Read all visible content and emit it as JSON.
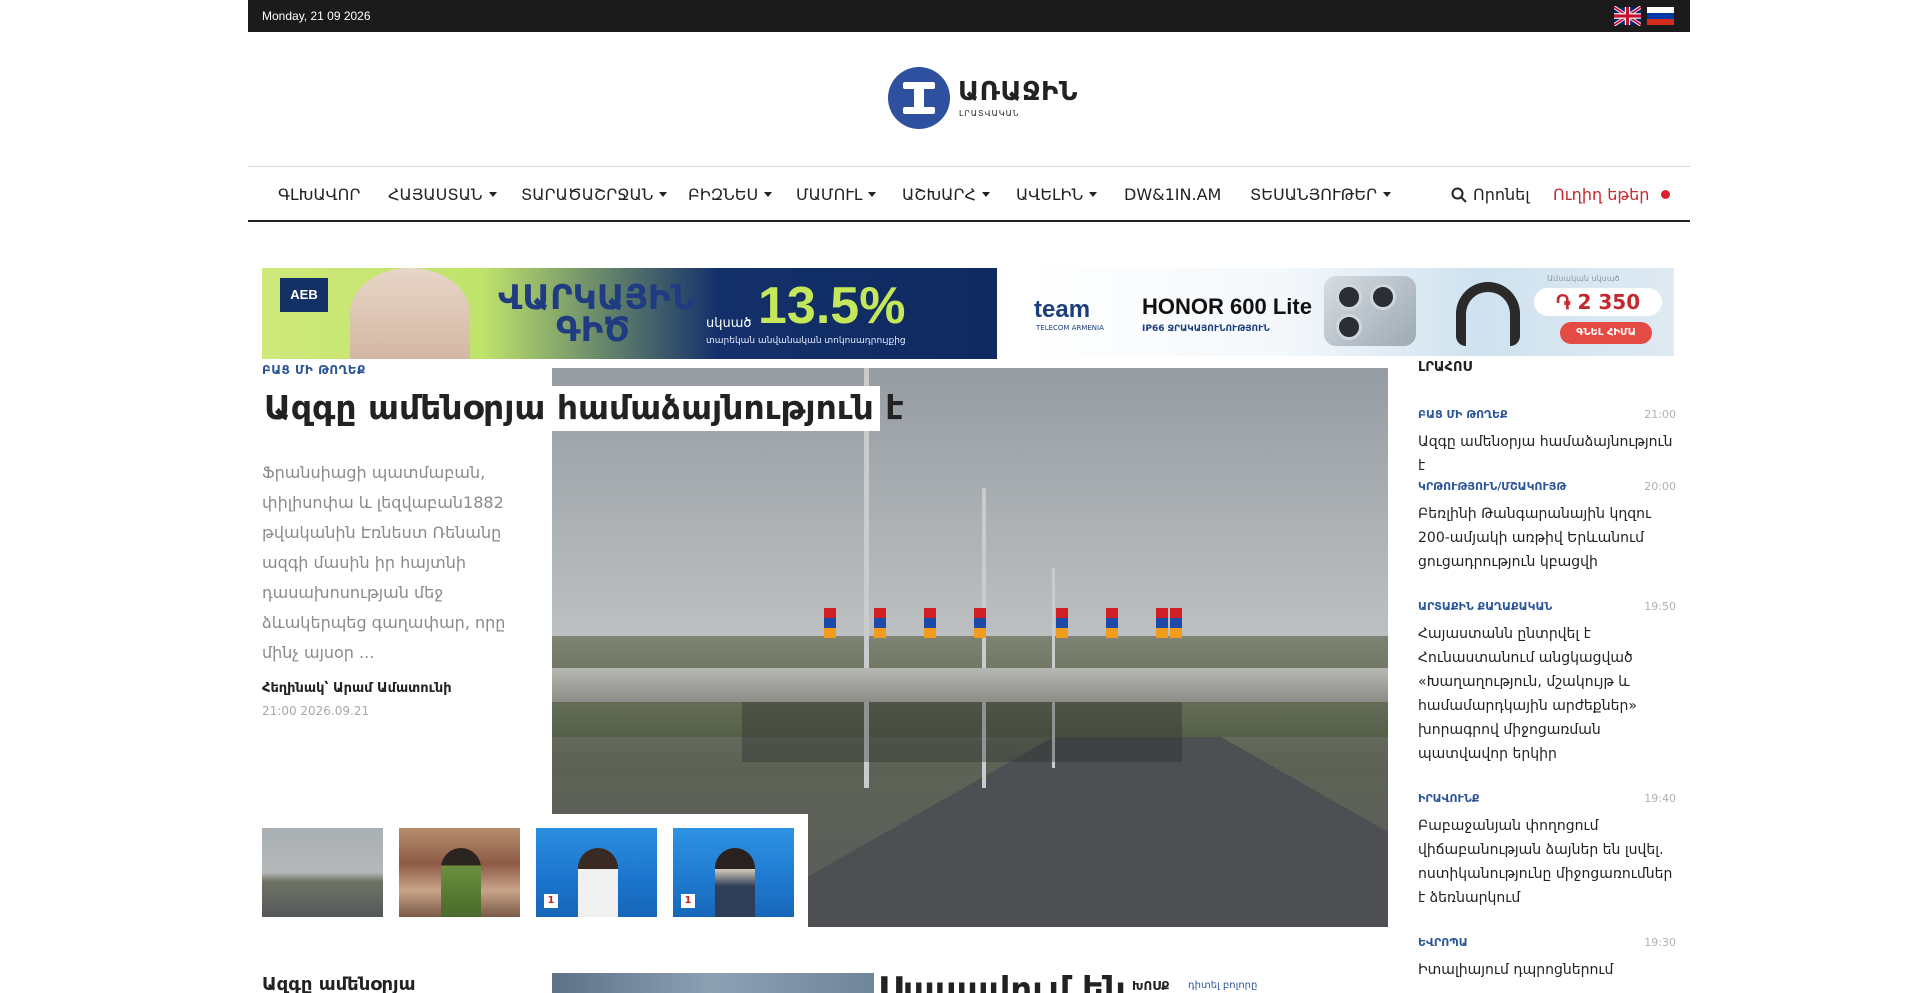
{
  "topbar": {
    "date": "Monday, 21 09 2026",
    "languages": [
      {
        "name": "English",
        "icon": "uk-flag-icon"
      },
      {
        "name": "Russian",
        "icon": "ru-flag-icon"
      }
    ]
  },
  "logo": {
    "name": "ԱՌԱՋԻՆ",
    "subtitle": "ԼՐԱՏՎԱԿԱՆ"
  },
  "nav": {
    "items": [
      {
        "label": "ԳԼԽԱՎՈՐ",
        "dropdown": false
      },
      {
        "label": "ՀԱՅԱՍՏԱՆ",
        "dropdown": true
      },
      {
        "label": "ՏԱՐԱԾԱՇՐՋԱՆ",
        "dropdown": true
      },
      {
        "label": "ԲԻԶՆԵՍ",
        "dropdown": true
      },
      {
        "label": "ՄԱՄՈՒԼ",
        "dropdown": true
      },
      {
        "label": "ԱՇԽԱՐՀ",
        "dropdown": true
      },
      {
        "label": "ԱՎԵԼԻՆ",
        "dropdown": true
      },
      {
        "label": "DW&1IN.AM",
        "dropdown": false
      },
      {
        "label": "ՏԵՍԱՆՅՈՒԹԵՐ",
        "dropdown": true
      }
    ],
    "search_label": "Որոնել",
    "live_label": "Ուղիղ եթեր"
  },
  "banners": {
    "left": {
      "brand": "AEB",
      "title": "ՎԱՐԿԱՅԻՆ ԳԻԾ",
      "prefix": "սկսած",
      "rate": "13.5%",
      "note": "տարեկան անվանական տոկոսադրույքից"
    },
    "right": {
      "brand": "team",
      "brand_sub": "TELECOM ARMENIA",
      "product": "HONOR 600 Lite",
      "product_sub": "IP66 ՋՐԱԿԱՅՈՒՆՈՒԹՅՈՒՆ",
      "price_top": "Ամսական սկսած",
      "price": "֏ 2 350",
      "button": "ԳՆԵԼ ՀԻՄԱ"
    }
  },
  "hero": {
    "category": "ԲԱՑ ՄԻ ԹՈՂԵՔ",
    "title": "Ազգը ամենօրյա համաձայնություն է",
    "lead": "Ֆրանսիացի պատմաբան, փիլիսոփա և լեզվաբան1882 թվականին Էռնեստ Ռենանը ազգի մասին իր հայտնի դասախոսության մեջ ձևակերպեց գաղափար, որը մինչ այսօր ...",
    "author": "Հեղինակ՝ Արամ Ամատունի",
    "time": "21:00 2026.09.21"
  },
  "sidebar": {
    "title": "ԼՐԱՀՈՍ",
    "items": [
      {
        "category": "ԲԱՑ ՄԻ ԹՈՂԵՔ",
        "time": "21:00",
        "title": "Ազգը ամենօրյա համաձայնություն է"
      },
      {
        "category": "ԿՐԹՈՒԹՅՈՒՆ/ՄՇԱԿՈՒՅԹ",
        "time": "20:00",
        "title": "Բեռլինի Թանգարանային կղզու 200-ամյակի առթիվ Երևանում ցուցադրություն կբացվի"
      },
      {
        "category": "ԱՐՏԱՔԻՆ ՔԱՂԱՔԱԿԱՆ",
        "time": "19:50",
        "title": "Հայաստանն ընտրվել է Հունաստանում անցկացված «Խաղաղություն, մշակույթ և համամարդկային արժեքներ» խորագրով միջոցառման պատվավոր երկիր"
      },
      {
        "category": "ԻՐԱՎՈՒՆՔ",
        "time": "19:40",
        "title": "Բաբաջանյան փողոցում վիճաբանության ձայներ են լսվել. ոստիկանությունը միջոցառումներ է ձեռնարկում"
      },
      {
        "category": "ԵՎՐՈՊԱ",
        "time": "19:30",
        "title": "Իտալիայում դպրոցներում"
      }
    ]
  },
  "bottom": {
    "left_title": "Ազգը ամենօրյա",
    "headline": "Սասավում են",
    "category": "ԽՈՍՔ",
    "author": "դիտել բոլորը"
  }
}
